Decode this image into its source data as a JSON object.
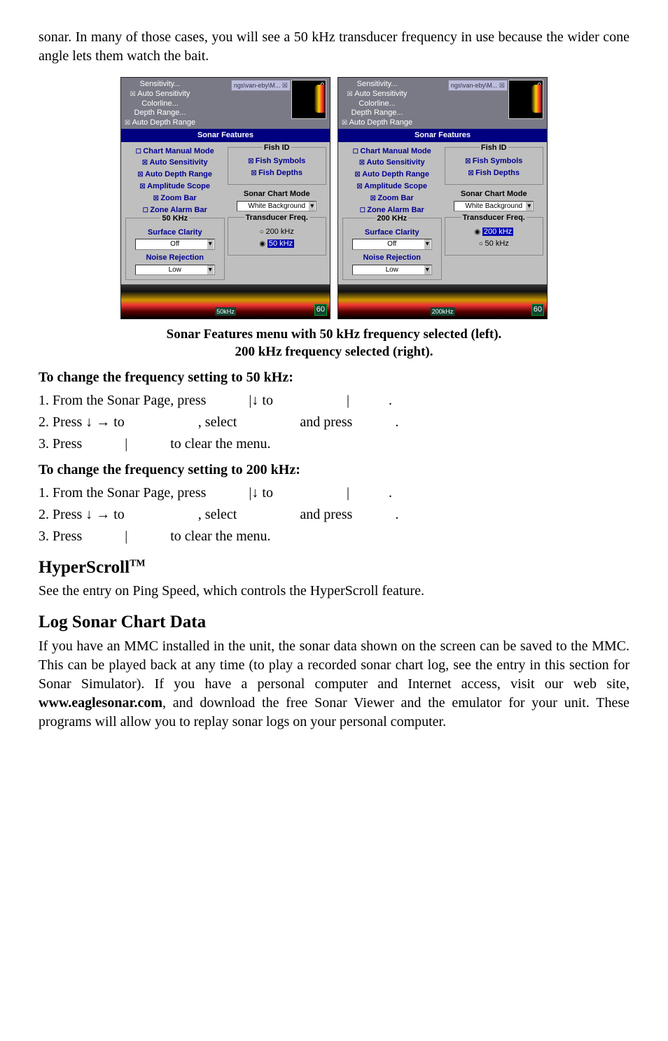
{
  "intro": "sonar. In many of those cases, you will see a 50 kHz transducer frequency in use because the wider cone angle lets them watch the bait.",
  "shots": {
    "tag": "ngs\\van-eby\\M... ☒",
    "topMenu": [
      "Sensitivity...",
      "Auto Sensitivity",
      "Colorline...",
      "Depth Range...",
      "Auto Depth Range"
    ],
    "dlgTitle": "Sonar Features",
    "leftCol": [
      "Chart Manual Mode",
      "Auto Sensitivity",
      "Auto Depth Range",
      "Amplitude Scope",
      "Zoom Bar",
      "Zone Alarm Bar"
    ],
    "surfaceLabel": "Surface Clarity",
    "surfaceVal": "Off",
    "noiseLabel": "Noise Rejection",
    "noiseVal": "Low",
    "fishIdTitle": "Fish ID",
    "fishSymbols": "Fish Symbols",
    "fishDepths": "Fish Depths",
    "chartModeTitle": "Sonar Chart Mode",
    "chartModeVal": "White Background",
    "transTitle": "Transducer Freq.",
    "opt200": "200 kHz",
    "opt50": "50 kHz",
    "left": {
      "khzGroup": "50 KHz",
      "freqLabel": "50kHz"
    },
    "right": {
      "khzGroup": "200 KHz",
      "freqLabel": "200kHz"
    },
    "zero": "0",
    "depth": "60"
  },
  "caption1": "Sonar Features menu with 50 kHz frequency selected (left).",
  "caption2": "200 kHz frequency selected (right).",
  "h50": "To change the frequency setting to 50 kHz:",
  "steps50": {
    "s1a": "1. From the Sonar Page, press ",
    "s1b": "|↓ to ",
    "s1c": "|",
    "s1d": ".",
    "s2a": "2. Press ↓ → to ",
    "s2b": ", select ",
    "s2c": " and press ",
    "s2d": ".",
    "s3a": "3. Press ",
    "s3b": "|",
    "s3c": " to clear the menu."
  },
  "h200": "To change the frequency setting to 200 kHz:",
  "steps200": {
    "s1a": "1. From the Sonar Page, press ",
    "s1b": "|↓ to ",
    "s1c": "|",
    "s1d": ".",
    "s2a": "2. Press ↓ →  to ",
    "s2b": ", select ",
    "s2c": " and  press ",
    "s2d": ".",
    "s3a": "3. Press ",
    "s3b": "|",
    "s3c": " to clear the menu."
  },
  "hyperTitle": "HyperScroll",
  "hyperText": "See the entry on Ping Speed, which controls the HyperScroll feature.",
  "logTitle": "Log Sonar Chart Data",
  "logText": "If you have an MMC installed in the unit, the sonar data shown on the screen can be saved to the MMC. This can be played back at any time (to play a recorded sonar chart log, see the entry in this section for Sonar Simulator). If you have a personal computer and Internet access, visit our web site, ",
  "logUrl": "www.eaglesonar.com",
  "logText2": ", and download the free Sonar Viewer and the emulator for your unit. These programs will allow you to replay sonar logs on your personal computer."
}
